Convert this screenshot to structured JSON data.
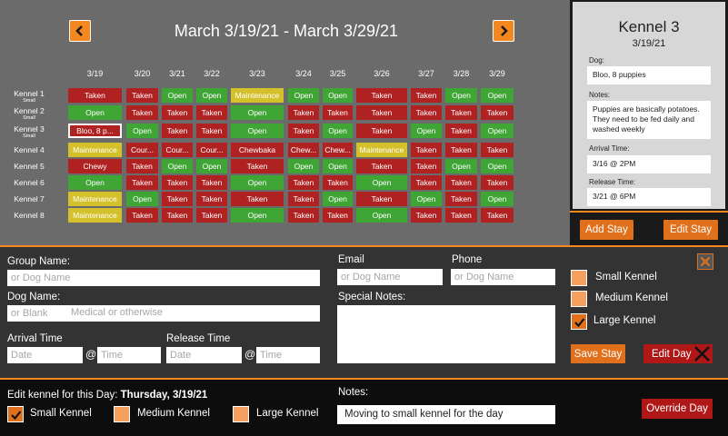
{
  "header": {
    "date_range": "March 3/19/21 - March 3/29/21",
    "prev_icon": "chevron-left-icon",
    "next_icon": "chevron-right-icon"
  },
  "schedule": {
    "dates": [
      "3/19",
      "3/20",
      "3/21",
      "3/22",
      "3/23",
      "3/24",
      "3/25",
      "3/26",
      "3/27",
      "3/28",
      "3/29"
    ],
    "kennels": [
      {
        "name": "Kennel 1",
        "size": "Small",
        "cells": [
          "Taken",
          "Taken",
          "Open",
          "Open",
          "Maintenance",
          "Open",
          "Open",
          "Taken",
          "Taken",
          "Open",
          "Open"
        ]
      },
      {
        "name": "Kennel 2",
        "size": "Small",
        "cells": [
          "Open",
          "Taken",
          "Taken",
          "Taken",
          "Open",
          "Taken",
          "Taken",
          "Taken",
          "Taken",
          "Taken",
          "Taken"
        ]
      },
      {
        "name": "Kennel 3",
        "size": "Small",
        "cells": [
          "Bloo, 8 p...",
          "Open",
          "Taken",
          "Taken",
          "Open",
          "Taken",
          "Open",
          "Taken",
          "Open",
          "Taken",
          "Open"
        ]
      },
      {
        "name": "Kennel 4",
        "size": "",
        "cells": [
          "Maintenance",
          "Cour...",
          "Cour...",
          "Cour...",
          "Chewbaka",
          "Chew...",
          "Chew...",
          "Maintenance",
          "Taken",
          "Taken",
          "Taken"
        ]
      },
      {
        "name": "Kennel 5",
        "size": "",
        "cells": [
          "Chewy",
          "Taken",
          "Open",
          "Open",
          "Taken",
          "Open",
          "Open",
          "Taken",
          "Taken",
          "Open",
          "Open"
        ]
      },
      {
        "name": "Kennel 6",
        "size": "",
        "cells": [
          "Open",
          "Taken",
          "Taken",
          "Taken",
          "Open",
          "Taken",
          "Taken",
          "Open",
          "Taken",
          "Taken",
          "Taken"
        ]
      },
      {
        "name": "Kennel 7",
        "size": "",
        "cells": [
          "Maintenance",
          "Open",
          "Taken",
          "Taken",
          "Taken",
          "Taken",
          "Open",
          "Taken",
          "Open",
          "Taken",
          "Open"
        ]
      },
      {
        "name": "Kennel 8",
        "size": "",
        "cells": [
          "Maintenance",
          "Taken",
          "Taken",
          "Taken",
          "Open",
          "Taken",
          "Taken",
          "Open",
          "Taken",
          "Taken",
          "Taken"
        ]
      }
    ]
  },
  "details": {
    "title": "Kennel 3",
    "date": "3/19/21",
    "dog_label": "Dog:",
    "dog": "Bloo, 8 puppies",
    "notes_label": "Notes:",
    "notes": "Puppies are basically potatoes. They need to be fed daily and washed weekly",
    "arrival_label": "Arrival Time:",
    "arrival": "3/16 @ 2PM",
    "release_label": "Release Time:",
    "release": "3/21 @ 6PM",
    "add_stay": "Add Stay",
    "edit_stay": "Edit Stay"
  },
  "form": {
    "group_name_label": "Group Name:",
    "group_name_placeholder": "or Dog Name",
    "dog_name_label": "Dog Name:",
    "dog_name_placeholder": "or Blank",
    "dog_name_hint": "Medical or otherwise",
    "arrival_label": "Arrival Time",
    "release_label": "Release Time",
    "date_placeholder": "Date",
    "time_placeholder": "Time",
    "at": "@",
    "email_label": "Email",
    "email_placeholder": "or Dog Name",
    "phone_label": "Phone",
    "phone_placeholder": "or Dog Name",
    "special_notes_label": "Special Notes:",
    "sizes": [
      {
        "label": "Small Kennel",
        "checked": false
      },
      {
        "label": "Medium Kennel",
        "checked": false
      },
      {
        "label": "Large Kennel",
        "checked": true
      }
    ],
    "save_stay": "Save Stay",
    "edit_day": "Edit Day"
  },
  "bottom": {
    "edit_prefix": "Edit kennel for this Day: ",
    "edit_day": "Thursday, 3/19/21",
    "sizes": [
      {
        "label": "Small Kennel",
        "checked": true
      },
      {
        "label": "Medium Kennel",
        "checked": false
      },
      {
        "label": "Large Kennel",
        "checked": false
      }
    ],
    "notes_label": "Notes:",
    "notes": "Moving to small kennel for the day",
    "override": "Override Day"
  },
  "colors": {
    "accent": "#f5871f",
    "taken": "#b02222",
    "open": "#3fa535",
    "maintenance": "#d4c02a"
  }
}
